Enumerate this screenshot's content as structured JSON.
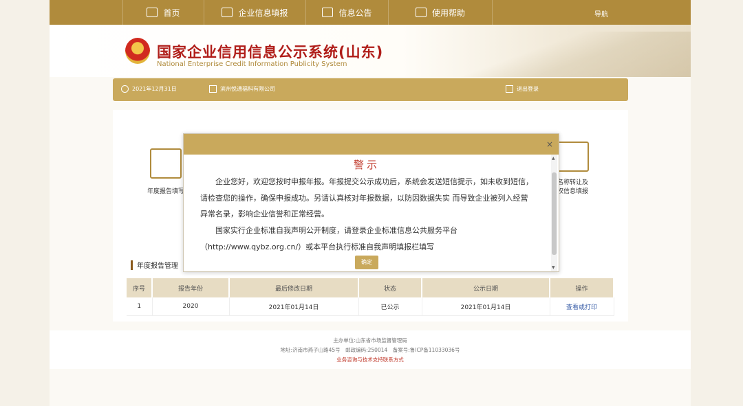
{
  "nav": {
    "home": "首页",
    "fill": "企业信息填报",
    "notice": "信息公告",
    "help": "使用帮助",
    "guide": "导航"
  },
  "header": {
    "title_cn": "国家企业信用信息公示系统(山东)",
    "title_en": "National Enterprise Credit Information Publicity System"
  },
  "infobar": {
    "date": "2021年12月31日",
    "company": "滨州悦通福科有限公司",
    "logout": "退出登录"
  },
  "main": {
    "left_label": "年度报告填写",
    "right_label_1": "名称转让及",
    "right_label_2": "权信息填报",
    "section_title": "年度报告管理"
  },
  "table": {
    "headers": [
      "序号",
      "报告年份",
      "最后修改日期",
      "状态",
      "公示日期",
      "操作"
    ],
    "rows": [
      [
        "1",
        "2020",
        "2021年01月14日",
        "已公示",
        "2021年01月14日",
        "查看或打印"
      ]
    ]
  },
  "modal": {
    "title": "警示",
    "close": "×",
    "para1": "企业您好，欢迎您按时申报年报。年报提交公示成功后，系统会发送短信提示，如未收到短信，请检查您的操作，确保申报成功。另请认真核对年报数据，以防因数据失实 而导致企业被列入经营异常名录，影响企业信誉和正常经营。",
    "para2": "国家实行企业标准自我声明公开制度，请登录企业标准信息公共服务平台（http://www.qybz.org.cn/）或本平台执行标准自我声明填报栏填写",
    "confirm": "确定"
  },
  "footer": {
    "line1": "主办单位:山东省市场监督管理局",
    "line2": "地址:济南市燕子山路45号　邮政编码:250014　备案号:鲁ICP备11033036号",
    "line3": "业务咨询与技术支持联系方式"
  }
}
